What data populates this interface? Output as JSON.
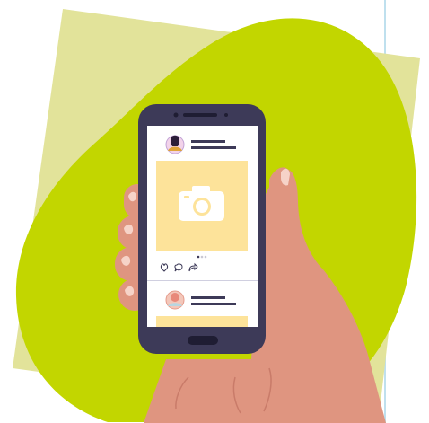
{
  "colors": {
    "square": "#e2e39a",
    "blob": "#c2d600",
    "hand": "#df9580",
    "hand_shadow": "#c97b69",
    "nail": "#f6d3c8",
    "phone_frame": "#3d3a58",
    "screen": "#ffffff",
    "photo_placeholder": "#fde39a",
    "avatar_1_bg": "#f2d3ea",
    "avatar_2_bg": "#f3c7ba",
    "text_placeholder": "#3d3a58",
    "guide": "#bfe0ee"
  },
  "icons": [
    "camera-icon",
    "heart-icon",
    "comment-icon",
    "share-icon"
  ],
  "feed": {
    "post_count": 2,
    "carousel_dots": 3,
    "active_dot": 1
  }
}
